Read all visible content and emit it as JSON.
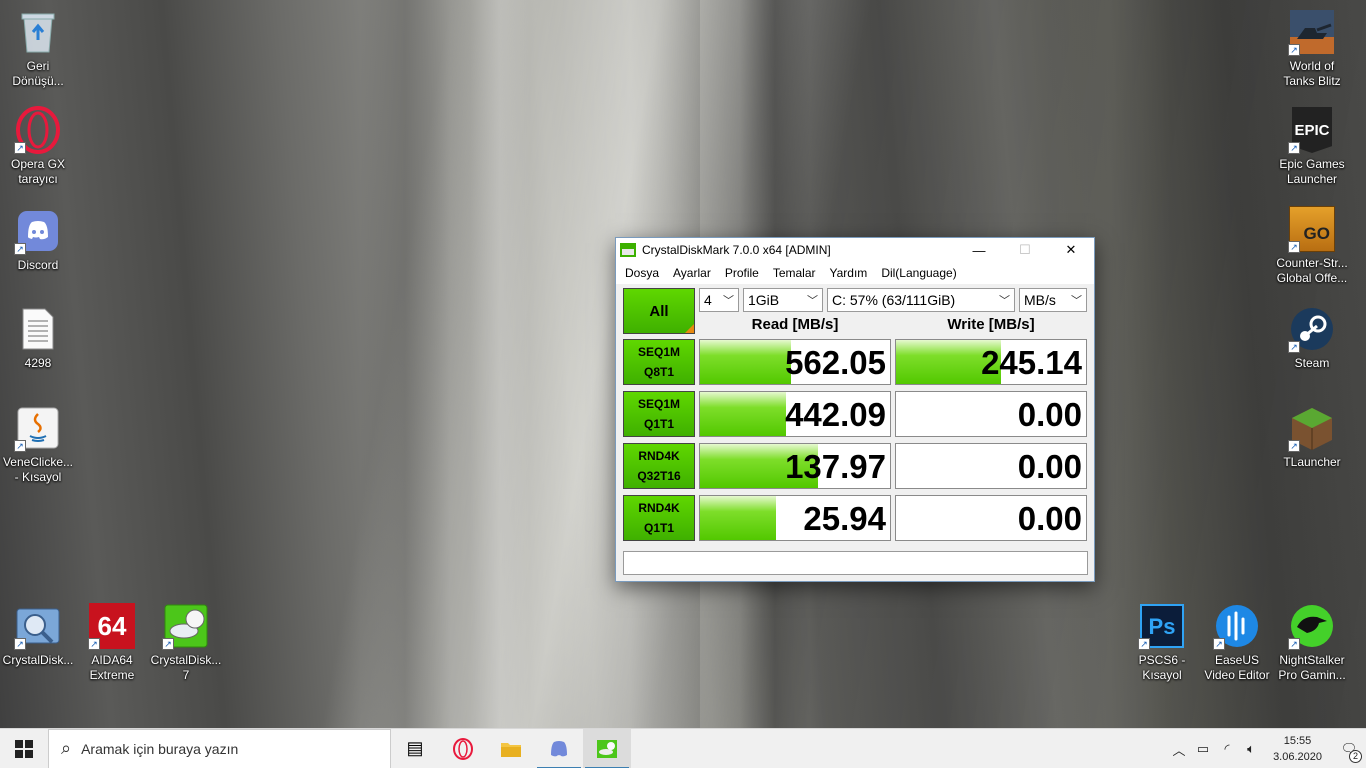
{
  "desktop": {
    "left_icons": [
      {
        "label": "Geri Dönüşü...",
        "icon": "recycle-bin-icon"
      },
      {
        "label": "Opera GX tarayıcı",
        "icon": "opera-gx-icon"
      },
      {
        "label": "Discord",
        "icon": "discord-icon"
      },
      {
        "label": "4298",
        "icon": "text-file-icon"
      },
      {
        "label": "VeneClicke... - Kısayol",
        "icon": "java-icon"
      }
    ],
    "bottom_left_icons": [
      {
        "label": "CrystalDisk...",
        "icon": "crystaldiskinfo-icon"
      },
      {
        "label": "AIDA64 Extreme",
        "icon": "aida64-icon",
        "glyph": "64"
      },
      {
        "label": "CrystalDisk... 7",
        "icon": "crystaldiskmark-icon"
      }
    ],
    "right_icons": [
      {
        "label": "World of Tanks Blitz",
        "icon": "world-of-tanks-icon"
      },
      {
        "label": "Epic Games Launcher",
        "icon": "epic-games-icon",
        "glyph": "EPIC"
      },
      {
        "label": "Counter-Str... Global Offe...",
        "icon": "csgo-icon",
        "glyph": "GO"
      },
      {
        "label": "Steam",
        "icon": "steam-icon"
      },
      {
        "label": "TLauncher",
        "icon": "tlauncher-icon"
      }
    ],
    "bottom_right_icons": [
      {
        "label": "PSCS6 - Kısayol",
        "icon": "photoshop-icon",
        "glyph": "Ps"
      },
      {
        "label": "EaseUS Video Editor",
        "icon": "easeus-video-icon"
      },
      {
        "label": "NightStalker Pro Gamin...",
        "icon": "nightstalker-icon"
      }
    ]
  },
  "window": {
    "title": "CrystalDiskMark 7.0.0 x64 [ADMIN]",
    "minimize": "—",
    "maximize": "☐",
    "close": "✕",
    "menu": [
      "Dosya",
      "Ayarlar",
      "Profile",
      "Temalar",
      "Yardım",
      "Dil(Language)"
    ],
    "all_button": "All",
    "count_select": "4",
    "size_select": "1GiB",
    "drive_select": "C: 57% (63/111GiB)",
    "unit_select": "MB/s",
    "read_header": "Read [MB/s]",
    "write_header": "Write [MB/s]",
    "tests": [
      {
        "line1": "SEQ1M",
        "line2": "Q8T1",
        "read": "562.05",
        "write": "245.14",
        "read_fill": 0.48,
        "write_fill": 0.55
      },
      {
        "line1": "SEQ1M",
        "line2": "Q1T1",
        "read": "442.09",
        "write": "0.00",
        "read_fill": 0.45,
        "write_fill": 0
      },
      {
        "line1": "RND4K",
        "line2": "Q32T16",
        "read": "137.97",
        "write": "0.00",
        "read_fill": 0.62,
        "write_fill": 0
      },
      {
        "line1": "RND4K",
        "line2": "Q1T1",
        "read": "25.94",
        "write": "0.00",
        "read_fill": 0.4,
        "write_fill": 0
      }
    ],
    "comment": ""
  },
  "taskbar": {
    "search_placeholder": "Aramak için buraya yazın",
    "time": "15:55",
    "date": "3.06.2020",
    "notifications": "2"
  },
  "colors": {
    "accent_green": "#52c800",
    "taskbar": "#f0f0f0"
  }
}
